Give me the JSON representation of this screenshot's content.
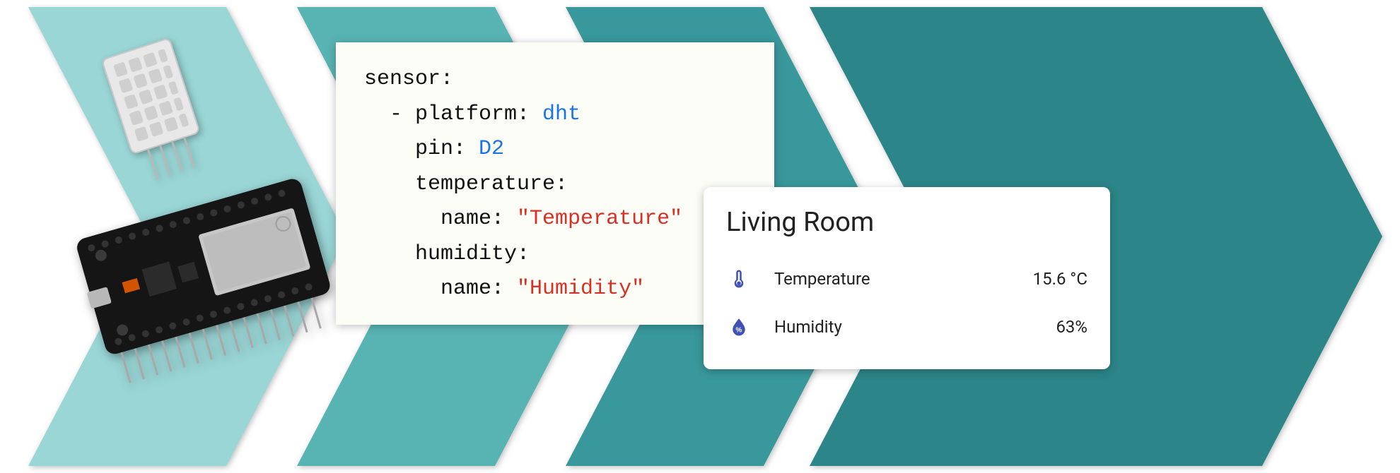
{
  "code": {
    "l1": "sensor:",
    "l2a": "  - platform: ",
    "l2b": "dht",
    "l3a": "    pin: ",
    "l3b": "D2",
    "l4": "    temperature:",
    "l5a": "      name: ",
    "l5b": "\"Temperature\"",
    "l6": "    humidity:",
    "l7a": "      name: ",
    "l7b": "\"Humidity\""
  },
  "widget": {
    "title": "Living Room",
    "rows": [
      {
        "icon": "thermometer-icon",
        "label": "Temperature",
        "value": "15.6 °C"
      },
      {
        "icon": "water-percent-icon",
        "label": "Humidity",
        "value": "63%"
      }
    ]
  },
  "colors": {
    "chevron1": "#9ad6d6",
    "chevron2": "#58b3b3",
    "chevron3": "#39989b",
    "chevron4": "#2c8588",
    "chevron_shadow": "#1d6a51",
    "icon_blue": "#3f51b5"
  }
}
